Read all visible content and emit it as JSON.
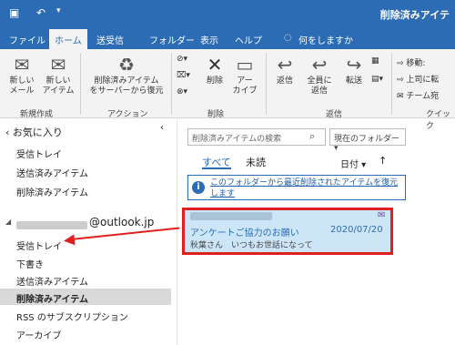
{
  "titlebar": {
    "title": "削除済みアイテ"
  },
  "tabs": [
    "ファイル",
    "ホーム",
    "送受信",
    "フォルダー",
    "表示",
    "ヘルプ"
  ],
  "tell_me": "何をしますか",
  "ribbon": {
    "new_mail": "新しい\nメール",
    "new_items": "新しい\nアイテム",
    "group_new": "新規作成",
    "recover": "削除済みアイテム\nをサーバーから復元",
    "group_actions": "アクション",
    "delete": "削除",
    "archive": "アー\nカイブ",
    "group_delete": "削除",
    "reply": "返信",
    "reply_all": "全員に\n返信",
    "forward": "転送",
    "group_respond": "返信",
    "move": "移動:",
    "to_manager": "上司に転",
    "team_email": "チーム宛",
    "quick": "クイック"
  },
  "nav": {
    "favorites": "お気に入り",
    "fav_items": [
      "受信トレイ",
      "送信済みアイテム",
      "削除済みアイテム"
    ],
    "account_suffix": "@outlook.jp",
    "account_items": [
      "受信トレイ",
      "下書き",
      "送信済みアイテム",
      "削除済みアイテム",
      "RSS のサブスクリプション",
      "アーカイブ"
    ]
  },
  "list": {
    "search_placeholder": "削除済みアイテムの検索",
    "scope": "現在のフォルダー",
    "filter_all": "すべて",
    "filter_unread": "未読",
    "sort": "日付",
    "info": "このフォルダーから最近削除されたアイテムを復元します",
    "mail": {
      "subject": "アンケートご協力のお願い",
      "date": "2020/07/20",
      "preview": "秋葉さん　いつもお世話になって"
    }
  },
  "colors": {
    "accent": "#2b6cb5",
    "highlight_border": "#e02020",
    "selected_mail": "#cde6f7"
  }
}
